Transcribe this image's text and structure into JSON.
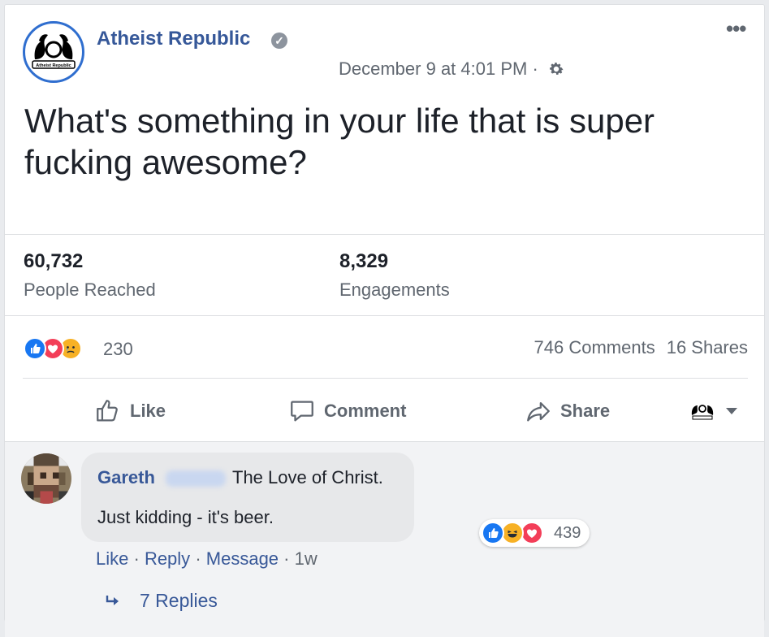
{
  "post": {
    "page_name": "Atheist Republic",
    "timestamp": "December 9 at 4:01 PM ·",
    "text": "What's something in your life that is super fucking awesome?",
    "avatar_caption": "Atheist Republic"
  },
  "stats": {
    "reached_value": "60,732",
    "reached_label": "People Reached",
    "engagements_value": "8,329",
    "engagements_label": "Engagements"
  },
  "reactions": {
    "count": "230",
    "comments": "746 Comments",
    "shares": "16 Shares"
  },
  "actions": {
    "like": "Like",
    "comment": "Comment",
    "share": "Share"
  },
  "comment": {
    "author": "Gareth",
    "text_line1": "The Love of Christ.",
    "text_line2": "Just kidding - it's beer.",
    "reaction_count": "439",
    "like": "Like",
    "reply": "Reply",
    "message": "Message",
    "time": "1w",
    "replies": "7 Replies"
  },
  "colors": {
    "link_blue": "#365899",
    "like_blue": "#1877f2",
    "love_red": "#f33e58",
    "haha_yellow": "#f7b125",
    "gray_text": "#606770"
  }
}
